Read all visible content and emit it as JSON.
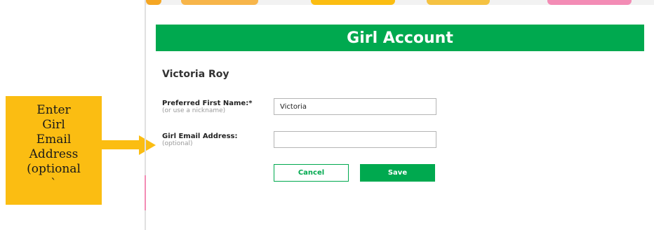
{
  "callout": {
    "text": "Enter\nGirl\nEmail\nAddress\n(optional\n`"
  },
  "header": {
    "title": "Girl Account"
  },
  "girl": {
    "name": "Victoria Roy"
  },
  "form": {
    "first_name": {
      "label_bold": "Preferred",
      "label_rest": " First Name:*",
      "hint": "(or use a nickname)",
      "value": "Victoria"
    },
    "email": {
      "label": "Girl Email Address:",
      "hint": "(optional)",
      "value": "",
      "placeholder": ""
    }
  },
  "buttons": {
    "cancel": "Cancel",
    "save": "Save"
  },
  "colors": {
    "brand_green": "#00a94f",
    "callout_yellow": "#fbbd12"
  }
}
